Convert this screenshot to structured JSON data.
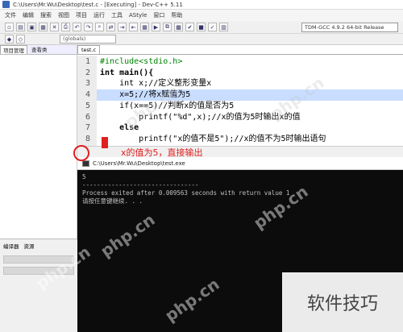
{
  "window": {
    "title": "C:\\Users\\Mr.Wu\\Desktop\\test.c - [Executing] - Dev-C++ 5.11"
  },
  "menu": [
    "文件",
    "编辑",
    "搜索",
    "视图",
    "项目",
    "运行",
    "工具",
    "AStyle",
    "窗口",
    "帮助"
  ],
  "toolbar": {
    "compiler": "TDM-GCC 4.9.2 64-bit Release",
    "scope": "(globals)"
  },
  "left_panel": {
    "tabs": [
      "项目管理",
      "查看类"
    ],
    "bottom_tabs": [
      "编译器",
      "资源"
    ]
  },
  "editor": {
    "tab": "test.c",
    "lines": [
      {
        "n": "1",
        "code": "#include<stdio.h>"
      },
      {
        "n": "2",
        "code": "int main(){"
      },
      {
        "n": "3",
        "code": "    int x;//定义整形变量x"
      },
      {
        "n": "4",
        "code": "    x=5;//将x赋值为5"
      },
      {
        "n": "5",
        "code": "    if(x==5)//判断x的值是否为5"
      },
      {
        "n": "6",
        "code": "        printf(\"%d\",x);//x的值为5时输出x的值"
      },
      {
        "n": "7",
        "code": "    else"
      },
      {
        "n": "8",
        "code": "        printf(\"x的值不是5\");//x的值不为5时输出语句"
      }
    ]
  },
  "annotation": "x的值为5，直接输出",
  "console": {
    "title": "C:\\Users\\Mr.Wu\\Desktop\\test.exe",
    "output": "5",
    "separator": "--------------------------------",
    "exit_line": "Process exited after 0.009563 seconds with return value 1",
    "prompt": "请按任意键继续. . ."
  },
  "watermarks": [
    "php.cn",
    "php.cn",
    "php.cn",
    "php.cn",
    "php.cn",
    "php.cn"
  ],
  "brand_box": "软件技巧",
  "colors": {
    "highlight": "#c8ddff",
    "comment": "#3a5cd6",
    "annotation": "#e02020",
    "console_bg": "#0c0c0c"
  }
}
